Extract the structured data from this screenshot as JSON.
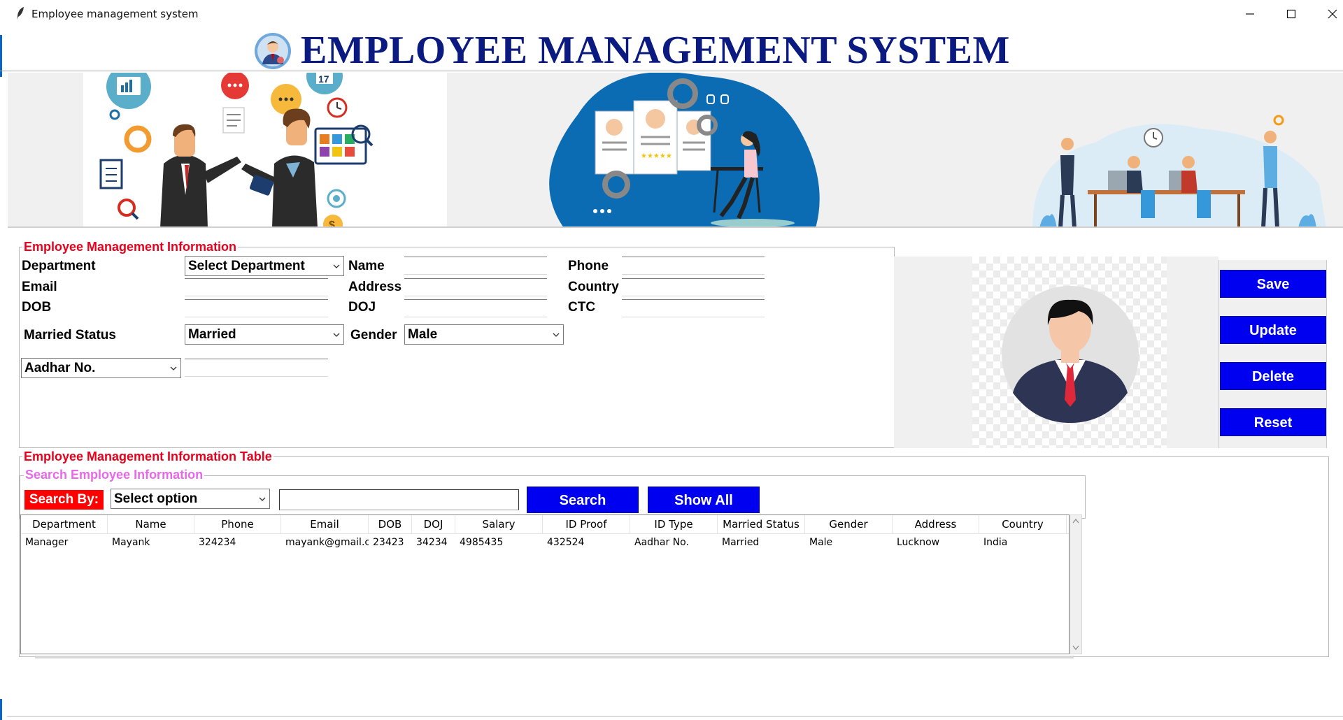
{
  "window": {
    "title": "Employee management system"
  },
  "heading": {
    "title": "EMPLOYEE MANAGEMENT SYSTEM"
  },
  "banner": {
    "calendar_number": "17"
  },
  "form": {
    "group_title": "Employee Management Information",
    "labels": {
      "department": "Department",
      "email": "Email",
      "dob": "DOB",
      "married_status": "Married Status",
      "name": "Name",
      "address": "Address",
      "doj": "DOJ",
      "gender": "Gender",
      "phone": "Phone",
      "country": "Country",
      "ctc": "CTC"
    },
    "selects": {
      "department": "Select Department",
      "married_status": "Married",
      "gender": "Male",
      "id_proof": "Aadhar No."
    }
  },
  "actions": {
    "save": "Save",
    "update": "Update",
    "delete": "Delete",
    "reset": "Reset"
  },
  "table_section": {
    "group_title": "Employee Management Information Table",
    "search_group_title": "Search Employee Information",
    "search_by_label": "Search By:",
    "search_option": "Select option",
    "search_button": "Search",
    "show_all_button": "Show All"
  },
  "table": {
    "columns": [
      "Department",
      "Name",
      "Phone",
      "Email",
      "DOB",
      "DOJ",
      "Salary",
      "ID Proof",
      "ID Type",
      "Married Status",
      "Gender",
      "Address",
      "Country"
    ],
    "rows": [
      [
        "Manager",
        "Mayank",
        "324234",
        "mayank@gmail.c",
        "23423",
        "34234",
        "4985435",
        "432524",
        "Aadhar No.",
        "Married",
        "Male",
        "Lucknow",
        "India"
      ]
    ]
  },
  "colors": {
    "heading": "#0a1a80",
    "group_title": "#e8001c",
    "search_title": "#e868e8",
    "button_blue": "#0000f0",
    "search_by_bg": "#ff0000"
  }
}
